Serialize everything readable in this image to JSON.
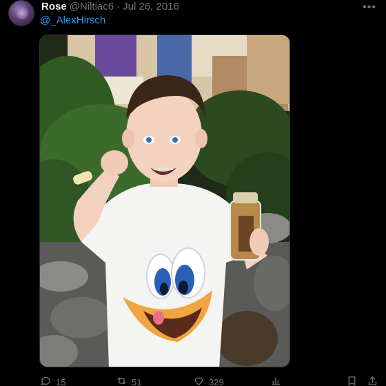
{
  "tweet": {
    "author_name": "Rose",
    "author_handle": "@Niltiac6",
    "separator": "·",
    "date": "Jul 26, 2016",
    "body_text": "@_AlexHirsch",
    "more_icon": "more-horizontal-icon"
  },
  "actions": {
    "replies": "15",
    "retweets": "51",
    "likes": "329"
  },
  "colors": {
    "background": "#000000",
    "text_primary": "#e7e9ea",
    "text_secondary": "#71767b",
    "link": "#1d9bf0"
  },
  "icons": [
    "reply-icon",
    "retweet-icon",
    "like-icon",
    "views-icon",
    "bookmark-icon",
    "share-icon"
  ]
}
